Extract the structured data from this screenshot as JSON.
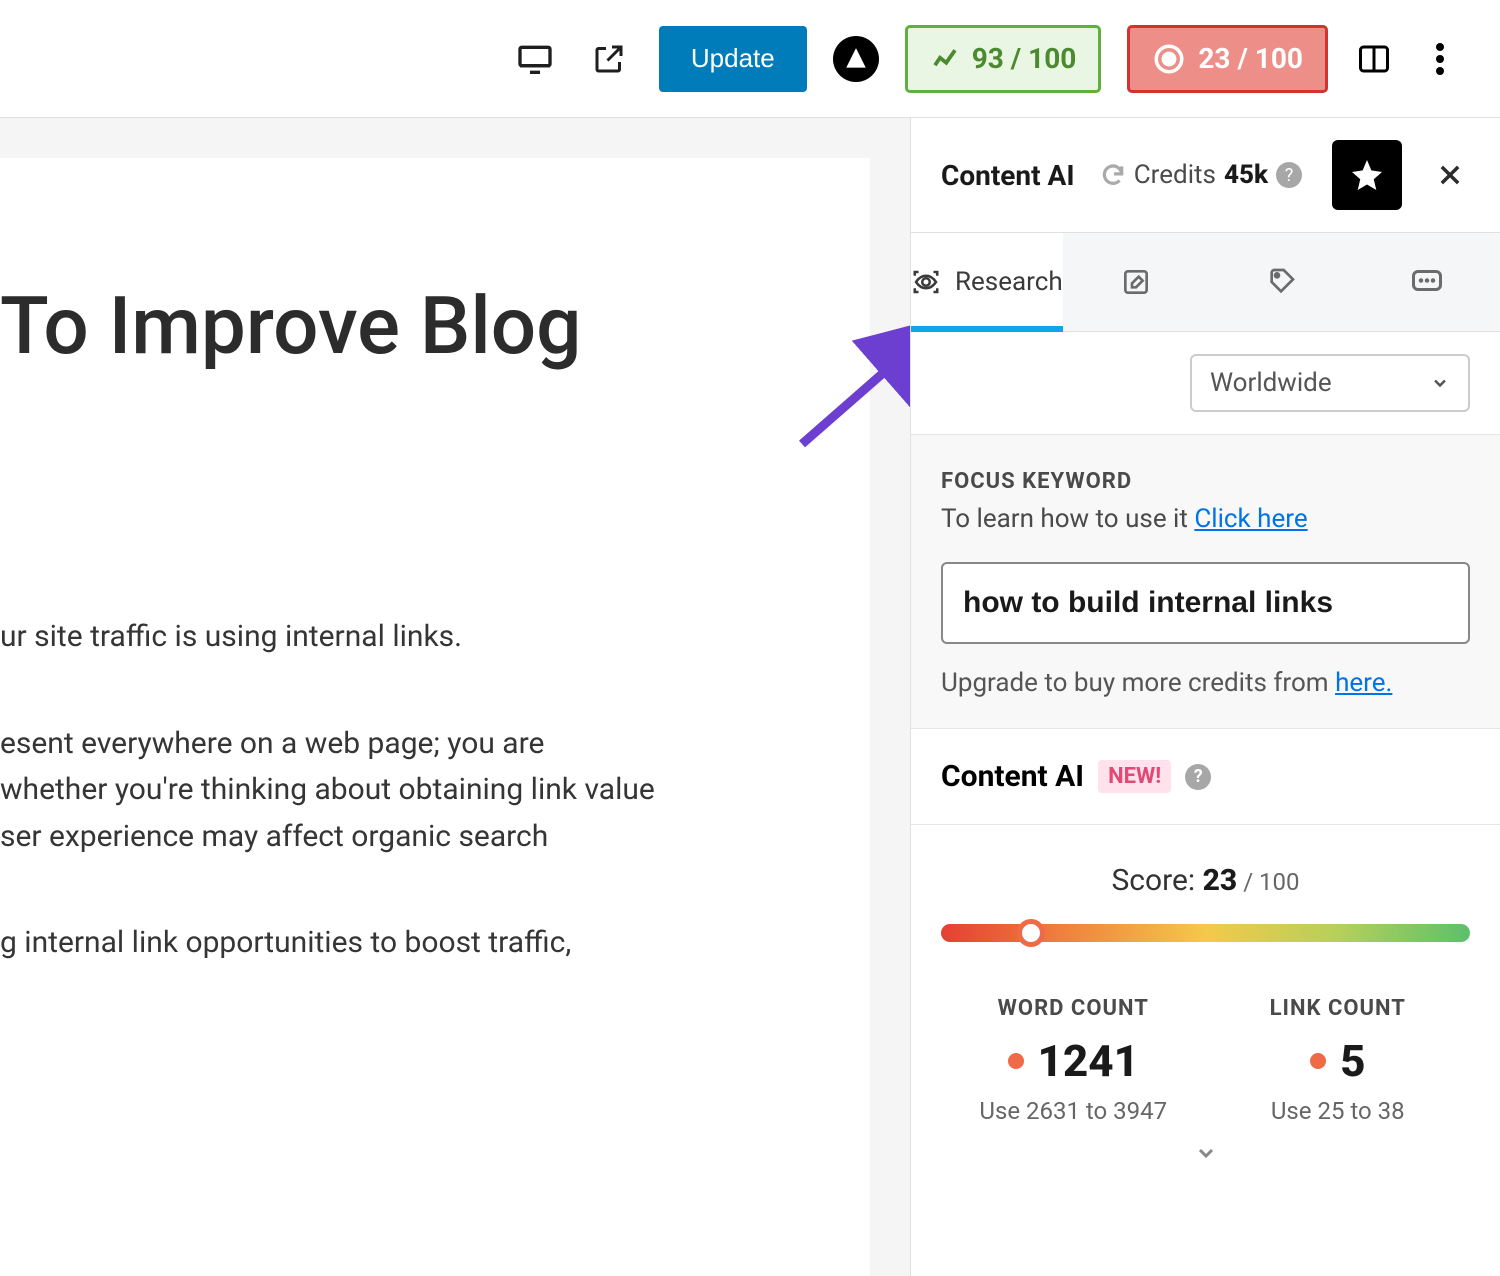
{
  "toolbar": {
    "update_label": "Update",
    "seo_score": "93 / 100",
    "ai_score": "23 / 100"
  },
  "editor": {
    "title_fragment": "To Improve Blog",
    "p1": "ur site traffic is using internal links.",
    "p2a": "esent everywhere on a web page; you are",
    "p2b": "whether you're thinking about obtaining link value",
    "p2c": "ser experience may affect organic search",
    "p3": "g internal link opportunities to boost traffic,"
  },
  "sidebar": {
    "title": "Content AI",
    "credits_label": "Credits",
    "credits_value": "45k",
    "tabs": {
      "research": "Research"
    },
    "region_selected": "Worldwide",
    "focus": {
      "label": "FOCUS KEYWORD",
      "help_text": "To learn how to use it ",
      "help_link": "Click here",
      "keyword": "how to build internal links",
      "upgrade_text": "Upgrade to buy more credits from ",
      "upgrade_link": "here."
    },
    "score_section": {
      "title": "Content AI",
      "new_badge": "NEW!",
      "score_prefix": "Score: ",
      "score_value": "23",
      "score_suffix": " / 100",
      "knob_percent": 17,
      "word_count": {
        "label": "WORD COUNT",
        "value": "1241",
        "hint": "Use 2631 to 3947"
      },
      "link_count": {
        "label": "LINK COUNT",
        "value": "5",
        "hint": "Use 25 to 38"
      }
    }
  }
}
